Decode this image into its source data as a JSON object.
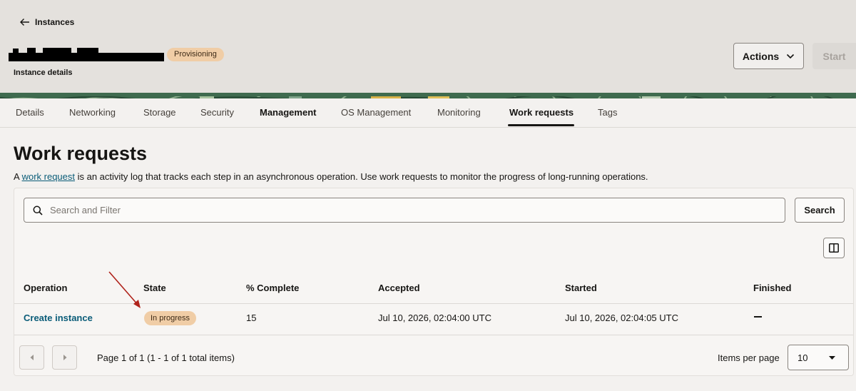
{
  "header": {
    "back_label": "Instances",
    "status_badge": "Provisioning",
    "subtitle": "Instance details",
    "actions_label": "Actions",
    "start_label": "Start"
  },
  "tabs": [
    {
      "label": "Details"
    },
    {
      "label": "Networking"
    },
    {
      "label": "Storage"
    },
    {
      "label": "Security"
    },
    {
      "label": "Management"
    },
    {
      "label": "OS Management"
    },
    {
      "label": "Monitoring"
    },
    {
      "label": "Work requests",
      "active": true
    },
    {
      "label": "Tags"
    }
  ],
  "main": {
    "title": "Work requests",
    "description_prefix": "A ",
    "description_link": "work request",
    "description_suffix": " is an activity log that tracks each step in an asynchronous operation. Use work requests to monitor the progress of long-running operations.",
    "search_placeholder": "Search and Filter",
    "search_button": "Search"
  },
  "table": {
    "columns": [
      "Operation",
      "State",
      "% Complete",
      "Accepted",
      "Started",
      "Finished"
    ],
    "rows": [
      {
        "operation": "Create instance",
        "state": "In progress",
        "percent_complete": "15",
        "accepted": "Jul 10, 2026, 02:04:00 UTC",
        "started": "Jul 10, 2026, 02:04:05 UTC",
        "finished": "—"
      }
    ]
  },
  "pagination": {
    "page_text": "Page 1 of 1 (1 - 1 of 1 total items)",
    "items_per_page_label": "Items per page",
    "items_per_page_value": "10"
  },
  "colors": {
    "link": "#0a5c78",
    "badge_bg": "#f0cda6",
    "annotation_arrow": "#b0231b",
    "header_bg": "#e4e1dd"
  },
  "icons": {
    "back": "arrow-left-icon",
    "dropdown": "chevron-down-icon",
    "search": "search-icon",
    "columns": "columns-icon",
    "prev": "caret-left-icon",
    "next": "caret-right-icon"
  }
}
